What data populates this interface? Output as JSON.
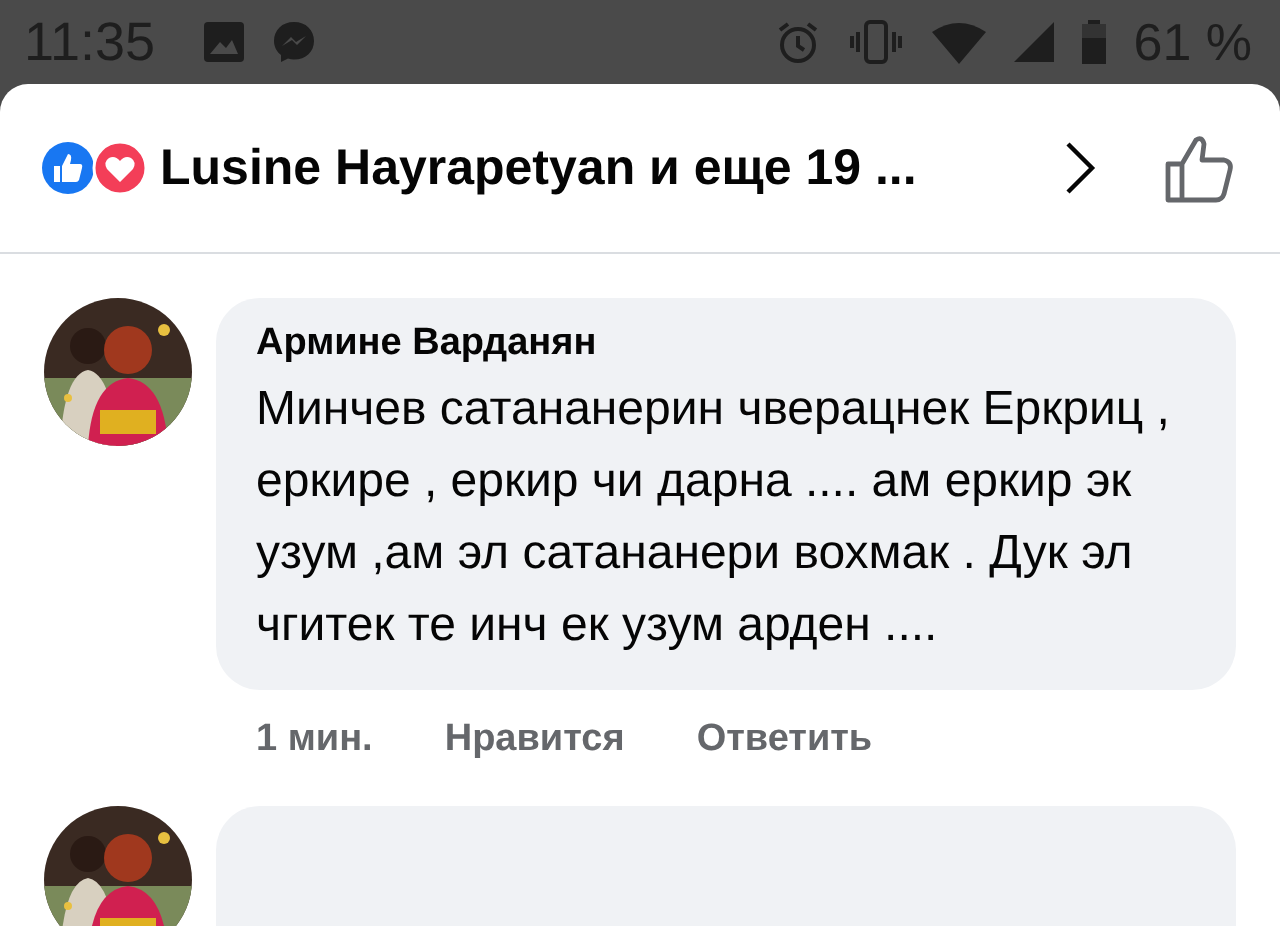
{
  "status_bar": {
    "time": "11:35",
    "battery": "61 %"
  },
  "header": {
    "reactions_text": "Lusine Hayrapetyan и еще 19 ..."
  },
  "comments": [
    {
      "avatar": {
        "kind": "picture"
      },
      "author": "Армине Варданян",
      "text": "Минчев сатананерин чверацнек Еркриц , еркире , еркир чи дарна .... ам еркир эк узум ,ам эл сатананери вохмак . Дук эл чгитек те инч ек узум арден ....",
      "time": "1 мин.",
      "actions": [
        "Нравится",
        "Ответить"
      ]
    },
    {
      "avatar": {
        "kind": "picture"
      }
    }
  ]
}
